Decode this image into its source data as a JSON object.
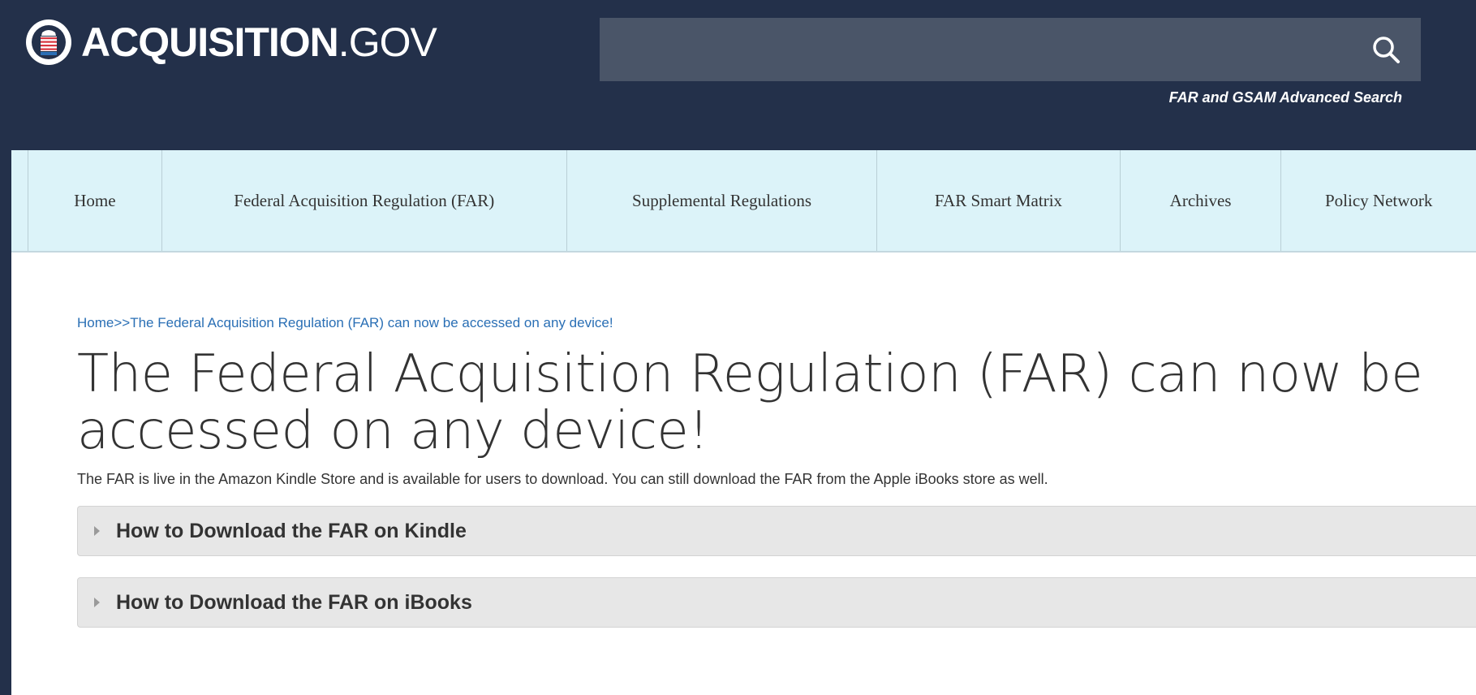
{
  "header": {
    "logo_bold": "ACQUISITION",
    "logo_thin": ".GOV",
    "search_placeholder": "",
    "advanced_search_label": "FAR and GSAM Advanced Search",
    "icons": {
      "seal": "gov-seal-icon",
      "search": "search-icon"
    }
  },
  "nav": {
    "items": [
      {
        "label": "Home"
      },
      {
        "label": "Federal Acquisition Regulation (FAR)"
      },
      {
        "label": "Supplemental Regulations"
      },
      {
        "label": "FAR Smart Matrix"
      },
      {
        "label": "Archives"
      },
      {
        "label": "Policy Network"
      }
    ]
  },
  "breadcrumb": {
    "home": "Home",
    "separator": ">>",
    "current": "The Federal Acquisition Regulation (FAR) can now be accessed on any device!"
  },
  "main": {
    "title": "The Federal Acquisition Regulation (FAR) can now be accessed on any device!",
    "intro": "The FAR is live in the Amazon Kindle Store and is available for users to download. You can still download the FAR from the Apple iBooks store as well.",
    "accordions": [
      {
        "label": "How to Download the FAR on Kindle"
      },
      {
        "label": "How to Download the FAR on iBooks"
      }
    ]
  },
  "colors": {
    "header_bg": "#23304a",
    "nav_bg": "#dcf3f9",
    "link": "#2a6fb5",
    "accordion_bg": "#e7e7e7"
  }
}
